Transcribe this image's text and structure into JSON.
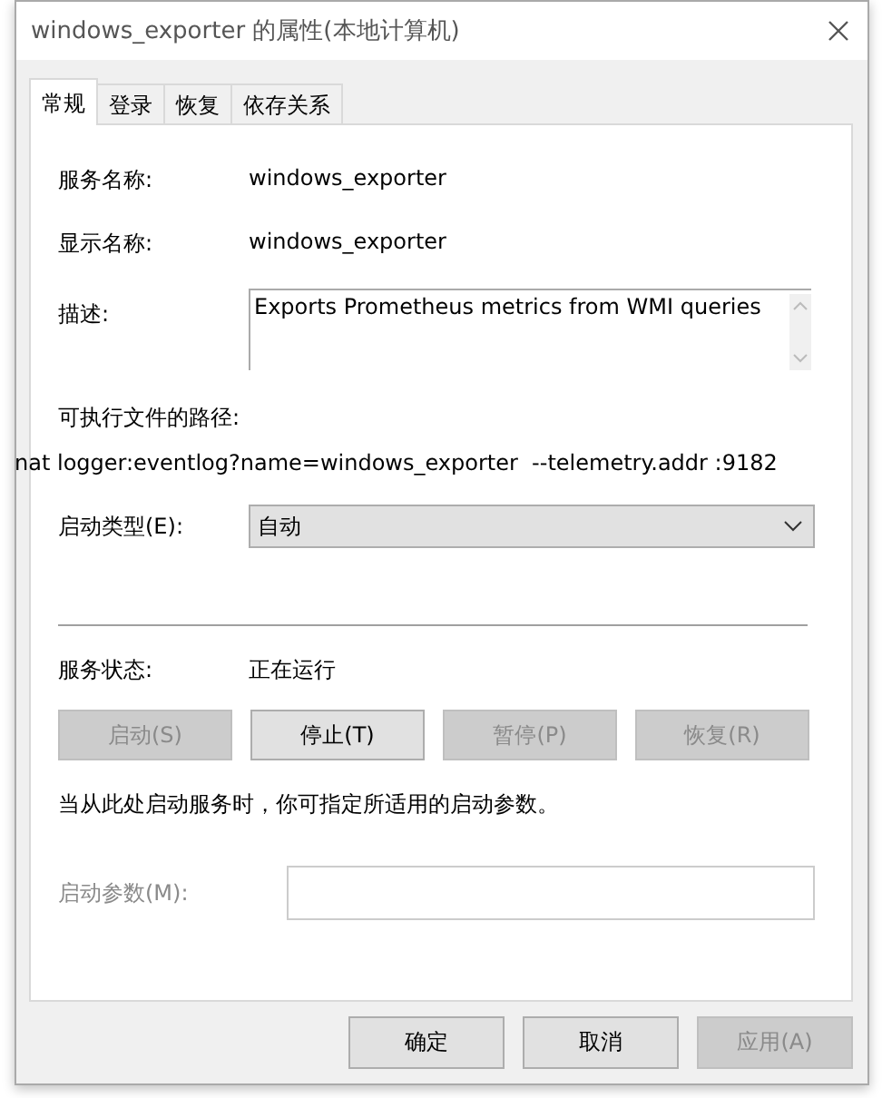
{
  "window": {
    "title": "windows_exporter 的属性(本地计算机)"
  },
  "tabs": [
    {
      "label": "常规",
      "selected": true
    },
    {
      "label": "登录",
      "selected": false
    },
    {
      "label": "恢复",
      "selected": false
    },
    {
      "label": "依存关系",
      "selected": false
    }
  ],
  "service_name": {
    "label": "服务名称:",
    "value": "windows_exporter"
  },
  "display_name": {
    "label": "显示名称:",
    "value": "windows_exporter"
  },
  "description": {
    "label": "描述:",
    "value": "Exports Prometheus metrics from WMI queries"
  },
  "executable_path": {
    "label": "可执行文件的路径:",
    "value": "nat logger:eventlog?name=windows_exporter  --telemetry.addr :9182"
  },
  "startup_type": {
    "label": "启动类型(E):",
    "value": "自动"
  },
  "service_status": {
    "label": "服务状态:",
    "value": "正在运行"
  },
  "service_buttons": [
    {
      "label": "启动(S)",
      "disabled": true
    },
    {
      "label": "停止(T)",
      "disabled": false
    },
    {
      "label": "暂停(P)",
      "disabled": true
    },
    {
      "label": "恢复(R)",
      "disabled": true
    }
  ],
  "hint": "当从此处启动服务时，你可指定所适用的启动参数。",
  "start_parameters": {
    "label": "启动参数(M):",
    "disabled": true
  },
  "dialog_buttons": [
    {
      "label": "确定",
      "disabled": false
    },
    {
      "label": "取消",
      "disabled": false
    },
    {
      "label": "应用(A)",
      "disabled": true
    }
  ]
}
